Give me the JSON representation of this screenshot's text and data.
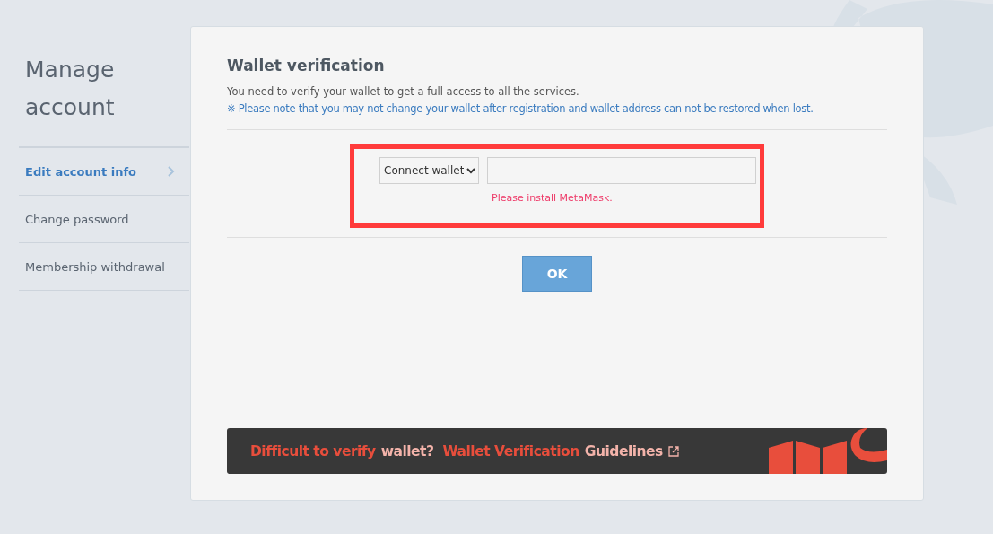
{
  "sidebar": {
    "title": "Manage account",
    "items": [
      {
        "label": "Edit account info",
        "selected": true
      },
      {
        "label": "Change password",
        "selected": false
      },
      {
        "label": "Membership withdrawal",
        "selected": false
      }
    ]
  },
  "panel": {
    "title": "Wallet verification",
    "description": "You need to verify your wallet to get a full access to all the services.",
    "notice": "※ Please note that you may not change your wallet after registration and wallet address can not be restored when lost.",
    "wallet_select": {
      "value": "Connect wallet"
    },
    "error": "Please install MetaMask.",
    "ok_button": "OK",
    "banner": {
      "segments": [
        {
          "text": "Difficult to verify",
          "color": "#e84e3c"
        },
        {
          "text": "wallet?",
          "color": "#f3b3aa"
        },
        {
          "text": "Wallet Verification",
          "color": "#e84e3c"
        },
        {
          "text": "Guidelines",
          "color": "#f3b3aa"
        }
      ]
    }
  }
}
